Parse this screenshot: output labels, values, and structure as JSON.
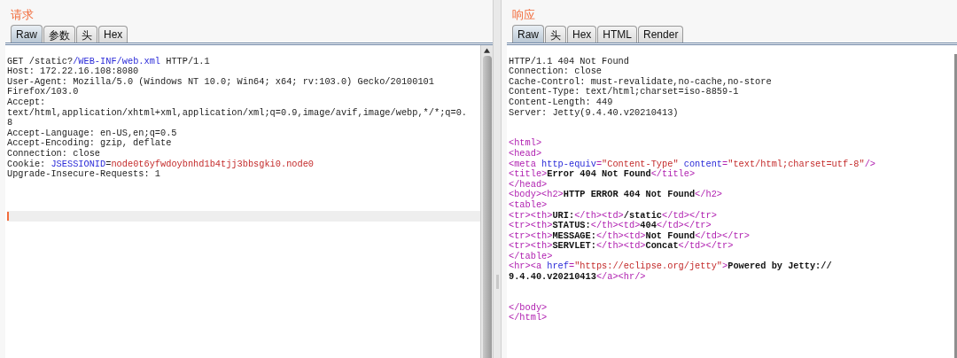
{
  "panels": [
    {
      "title": "请求",
      "tabs": [
        {
          "label": "Raw",
          "selected": true
        },
        {
          "label": "参数",
          "selected": false
        },
        {
          "label": "头",
          "selected": false
        },
        {
          "label": "Hex",
          "selected": false
        }
      ],
      "blocks": [
        [
          [
            {
              "kind": "plain",
              "text": "GET /static?"
            },
            {
              "kind": "param",
              "text": "/WEB-INF/web.xml"
            },
            {
              "kind": "plain",
              "text": " HTTP/1.1"
            }
          ],
          [
            {
              "kind": "plain",
              "text": "Host: 172.22.16.108:8080"
            }
          ],
          [
            {
              "kind": "plain",
              "text": "User-Agent: Mozilla/5.0 (Windows NT 10.0; Win64; x64; rv:103.0) Gecko/20100101"
            }
          ],
          [
            {
              "kind": "plain",
              "text": "Firefox/103.0"
            }
          ],
          [
            {
              "kind": "plain",
              "text": "Accept:"
            }
          ],
          [
            {
              "kind": "plain",
              "text": "text/html,application/xhtml+xml,application/xml;q=0.9,image/avif,image/webp,*/*;q=0."
            }
          ],
          [
            {
              "kind": "plain",
              "text": "8"
            }
          ],
          [
            {
              "kind": "plain",
              "text": "Accept-Language: en-US,en;q=0.5"
            }
          ],
          [
            {
              "kind": "plain",
              "text": "Accept-Encoding: gzip, deflate"
            }
          ],
          [
            {
              "kind": "plain",
              "text": "Connection: close"
            }
          ],
          [
            {
              "kind": "plain",
              "text": "Cookie: "
            },
            {
              "kind": "param",
              "text": "JSESSIONID"
            },
            {
              "kind": "plain",
              "text": "="
            },
            {
              "kind": "value",
              "text": "node0t6yfwdoybnhd1b4tjj3bbsgki0.node0"
            }
          ],
          [
            {
              "kind": "plain",
              "text": "Upgrade-Insecure-Requests: 1"
            }
          ]
        ]
      ]
    },
    {
      "title": "响应",
      "tabs": [
        {
          "label": "Raw",
          "selected": true
        },
        {
          "label": "头",
          "selected": false
        },
        {
          "label": "Hex",
          "selected": false
        },
        {
          "label": "HTML",
          "selected": false
        },
        {
          "label": "Render",
          "selected": false
        }
      ],
      "blocks": [
        [
          [
            {
              "kind": "plain",
              "text": "HTTP/1.1 404 Not Found"
            }
          ],
          [
            {
              "kind": "plain",
              "text": "Connection: close"
            }
          ],
          [
            {
              "kind": "plain",
              "text": "Cache-Control: must-revalidate,no-cache,no-store"
            }
          ],
          [
            {
              "kind": "plain",
              "text": "Content-Type: text/html;charset=iso-8859-1"
            }
          ],
          [
            {
              "kind": "plain",
              "text": "Content-Length: 449"
            }
          ],
          [
            {
              "kind": "plain",
              "text": "Server: Jetty(9.4.40.v20210413)"
            }
          ]
        ],
        [
          [
            {
              "kind": "tag",
              "text": "<html>"
            }
          ],
          [
            {
              "kind": "tag",
              "text": "<head>"
            }
          ],
          [
            {
              "kind": "tag",
              "text": "<meta "
            },
            {
              "kind": "param",
              "text": "http-equiv"
            },
            {
              "kind": "tag",
              "text": "="
            },
            {
              "kind": "value",
              "text": "\"Content-Type\""
            },
            {
              "kind": "param",
              "text": " content"
            },
            {
              "kind": "tag",
              "text": "="
            },
            {
              "kind": "value",
              "text": "\"text/html;charset=utf-8\""
            },
            {
              "kind": "tag",
              "text": "/>"
            }
          ],
          [
            {
              "kind": "tag",
              "text": "<title>"
            },
            {
              "kind": "bold",
              "text": "Error 404 Not Found"
            },
            {
              "kind": "tag",
              "text": "</title>"
            }
          ],
          [
            {
              "kind": "tag",
              "text": "</head>"
            }
          ],
          [
            {
              "kind": "tag",
              "text": "<body><h2>"
            },
            {
              "kind": "bold",
              "text": "HTTP ERROR 404 Not Found"
            },
            {
              "kind": "tag",
              "text": "</h2>"
            }
          ],
          [
            {
              "kind": "tag",
              "text": "<table>"
            }
          ],
          [
            {
              "kind": "tag",
              "text": "<tr><th>"
            },
            {
              "kind": "bold",
              "text": "URI:"
            },
            {
              "kind": "tag",
              "text": "</th><td>"
            },
            {
              "kind": "bold",
              "text": "/static"
            },
            {
              "kind": "tag",
              "text": "</td></tr>"
            }
          ],
          [
            {
              "kind": "tag",
              "text": "<tr><th>"
            },
            {
              "kind": "bold",
              "text": "STATUS:"
            },
            {
              "kind": "tag",
              "text": "</th><td>"
            },
            {
              "kind": "bold",
              "text": "404"
            },
            {
              "kind": "tag",
              "text": "</td></tr>"
            }
          ],
          [
            {
              "kind": "tag",
              "text": "<tr><th>"
            },
            {
              "kind": "bold",
              "text": "MESSAGE:"
            },
            {
              "kind": "tag",
              "text": "</th><td>"
            },
            {
              "kind": "bold",
              "text": "Not Found"
            },
            {
              "kind": "tag",
              "text": "</td></tr>"
            }
          ],
          [
            {
              "kind": "tag",
              "text": "<tr><th>"
            },
            {
              "kind": "bold",
              "text": "SERVLET:"
            },
            {
              "kind": "tag",
              "text": "</th><td>"
            },
            {
              "kind": "bold",
              "text": "Concat"
            },
            {
              "kind": "tag",
              "text": "</td></tr>"
            }
          ],
          [
            {
              "kind": "tag",
              "text": "</table>"
            }
          ],
          [
            {
              "kind": "tag",
              "text": "<hr><a "
            },
            {
              "kind": "param",
              "text": "href"
            },
            {
              "kind": "tag",
              "text": "="
            },
            {
              "kind": "value",
              "text": "\"https://eclipse.org/jetty\""
            },
            {
              "kind": "tag",
              "text": ">"
            },
            {
              "kind": "bold",
              "text": "Powered by Jetty://"
            }
          ],
          [
            {
              "kind": "bold",
              "text": "9.4.40.v20210413"
            },
            {
              "kind": "tag",
              "text": "</a><hr/>"
            }
          ]
        ],
        [
          [
            {
              "kind": "tag",
              "text": "</body>"
            }
          ],
          [
            {
              "kind": "tag",
              "text": "</html>"
            }
          ]
        ]
      ]
    }
  ]
}
